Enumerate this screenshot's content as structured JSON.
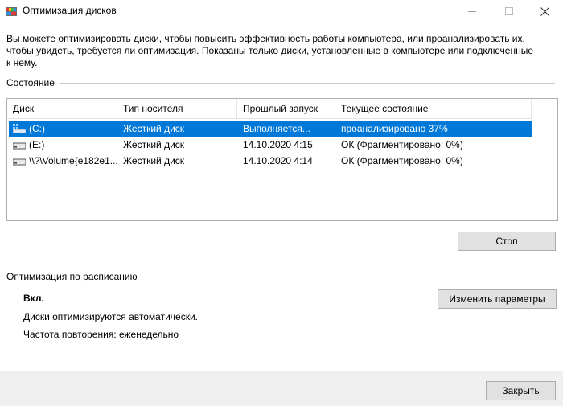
{
  "window": {
    "title": "Оптимизация дисков"
  },
  "intro_text": "Вы можете оптимизировать диски, чтобы повысить эффективность работы  компьютера, или проанализировать их, чтобы увидеть, требуется ли оптимизация. Показаны только диски, установленные в компьютере или подключенные к нему.",
  "status": {
    "section_label": "Состояние",
    "columns": [
      "Диск",
      "Тип носителя",
      "Прошлый запуск",
      "Текущее состояние"
    ],
    "rows": [
      {
        "disk": "(C:)",
        "media": "Жесткий диск",
        "last_run": "Выполняется...",
        "state": "проанализировано 37%",
        "icon": "windows-drive-icon",
        "selected": true
      },
      {
        "disk": "(E:)",
        "media": "Жесткий диск",
        "last_run": "14.10.2020 4:15",
        "state": "ОК (Фрагментировано: 0%)",
        "icon": "hard-drive-icon",
        "selected": false
      },
      {
        "disk": "\\\\?\\Volume{e182e1...",
        "media": "Жесткий диск",
        "last_run": "14.10.2020 4:14",
        "state": "ОК (Фрагментировано: 0%)",
        "icon": "hard-drive-icon",
        "selected": false
      }
    ],
    "stop_button": "Стоп"
  },
  "schedule": {
    "section_label": "Оптимизация по расписанию",
    "state": "Вкл.",
    "description": "Диски оптимизируются автоматически.",
    "frequency": "Частота повторения: еженедельно",
    "change_button": "Изменить параметры"
  },
  "footer": {
    "close_button": "Закрыть"
  },
  "colors": {
    "selection": "#0078d7",
    "button_bg": "#e1e1e1",
    "footer_bg": "#f0f0f0"
  }
}
